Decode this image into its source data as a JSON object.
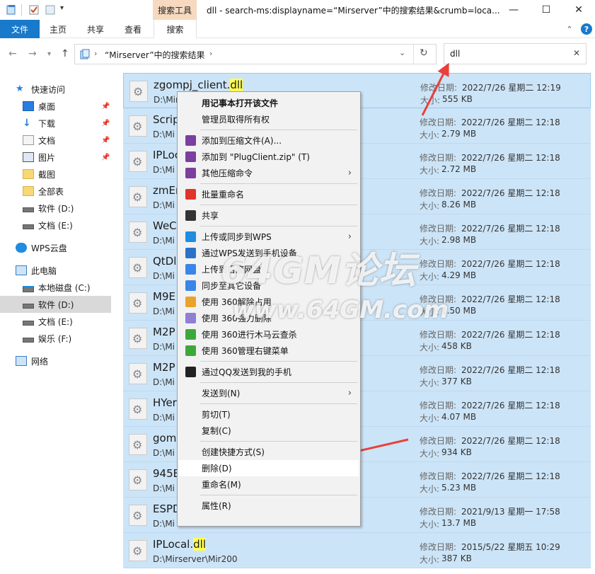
{
  "title_bar": {
    "context_tab": "搜索工具",
    "window_title": "dll - search-ms:displayname=“Mirserver”中的搜索结果&crumb=loca..."
  },
  "ribbon": {
    "tabs": [
      "文件",
      "主页",
      "共享",
      "查看",
      "搜索"
    ]
  },
  "address": {
    "path": "“Mirserver”中的搜索结果"
  },
  "search": {
    "value": "dll"
  },
  "sidebar": {
    "items": [
      {
        "label": "快速访问",
        "icon": "star-icon"
      },
      {
        "label": "桌面",
        "icon": "desktop-icon",
        "pinned": true
      },
      {
        "label": "下载",
        "icon": "download-icon",
        "pinned": true
      },
      {
        "label": "文档",
        "icon": "document-icon",
        "pinned": true
      },
      {
        "label": "图片",
        "icon": "picture-icon",
        "pinned": true
      },
      {
        "label": "截图",
        "icon": "folder-icon"
      },
      {
        "label": "全部表",
        "icon": "folder-icon"
      },
      {
        "label": "软件 (D:)",
        "icon": "drive-icon"
      },
      {
        "label": "文档 (E:)",
        "icon": "drive-icon"
      },
      {
        "label": "WPS云盘",
        "icon": "cloud-icon"
      },
      {
        "label": "此电脑",
        "icon": "computer-icon"
      },
      {
        "label": "本地磁盘 (C:)",
        "icon": "system-drive-icon"
      },
      {
        "label": "软件 (D:)",
        "icon": "drive-icon",
        "selected": true
      },
      {
        "label": "文档 (E:)",
        "icon": "drive-icon"
      },
      {
        "label": "娱乐 (F:)",
        "icon": "drive-icon"
      },
      {
        "label": "网络",
        "icon": "network-icon"
      }
    ]
  },
  "labels": {
    "modified": "修改日期:",
    "size": "大小:"
  },
  "files": [
    {
      "name_pre": "zgompj_client.",
      "name_hl": "dll",
      "path": "D:\\Mir",
      "modified": "2022/7/26 星期二 12:19",
      "size": "555 KB"
    },
    {
      "name_pre": "Scrip",
      "name_hl": "",
      "path": "D:\\Mi",
      "modified": "2022/7/26 星期二 12:18",
      "size": "2.79 MB"
    },
    {
      "name_pre": "IPLoc",
      "name_hl": "",
      "path": "D:\\Mi",
      "modified": "2022/7/26 星期二 12:18",
      "size": "2.72 MB"
    },
    {
      "name_pre": "zmEr",
      "name_hl": "",
      "path": "D:\\Mi",
      "modified": "2022/7/26 星期二 12:18",
      "size": "8.26 MB"
    },
    {
      "name_pre": "WeC",
      "name_hl": "",
      "path": "D:\\Mi",
      "modified": "2022/7/26 星期二 12:18",
      "size": "2.98 MB"
    },
    {
      "name_pre": "QtDl",
      "name_hl": "",
      "path": "D:\\Mi",
      "modified": "2022/7/26 星期二 12:18",
      "size": "4.29 MB"
    },
    {
      "name_pre": "M9E",
      "name_hl": "",
      "path": "D:\\Mi",
      "modified": "2022/7/26 星期二 12:18",
      "size": "1.50 MB"
    },
    {
      "name_pre": "M2P",
      "name_hl": "",
      "path": "D:\\Mi",
      "modified": "2022/7/26 星期二 12:18",
      "size": "458 KB"
    },
    {
      "name_pre": "M2P",
      "name_hl": "",
      "path": "D:\\Mi",
      "modified": "2022/7/26 星期二 12:18",
      "size": "377 KB"
    },
    {
      "name_pre": "HYer",
      "name_hl": "",
      "path": "D:\\Mi",
      "modified": "2022/7/26 星期二 12:18",
      "size": "4.07 MB"
    },
    {
      "name_pre": "gom",
      "name_hl": "",
      "path": "D:\\Mi",
      "modified": "2022/7/26 星期二 12:18",
      "size": "934 KB"
    },
    {
      "name_pre": "945E",
      "name_hl": "",
      "path": "D:\\Mi",
      "modified": "2022/7/26 星期二 12:18",
      "size": "5.23 MB"
    },
    {
      "name_pre": "ESPD",
      "name_hl": "",
      "path": "D:\\Mi",
      "modified": "2021/9/13 星期一 17:58",
      "size": "13.7 MB"
    },
    {
      "name_pre": "IPLocal.",
      "name_hl": "dll",
      "path": "D:\\Mirserver\\Mir200",
      "modified": "2015/5/22 星期五 10:29",
      "size": "387 KB"
    }
  ],
  "context_menu": [
    {
      "label": "用记事本打开该文件",
      "bold": true
    },
    {
      "label": "管理员取得所有权"
    },
    {
      "sep": true
    },
    {
      "label": "添加到压缩文件(A)...",
      "icon": "winrar-icon",
      "color": "#7a3fa0"
    },
    {
      "label": "添加到 \"PlugClient.zip\" (T)",
      "icon": "winrar-icon",
      "color": "#7a3fa0"
    },
    {
      "label": "其他压缩命令",
      "icon": "winrar-icon",
      "color": "#7a3fa0",
      "submenu": true
    },
    {
      "sep": true
    },
    {
      "label": "批量重命名",
      "icon": "wps-icon",
      "color": "#e0332a"
    },
    {
      "sep": true
    },
    {
      "label": "共享",
      "icon": "share-icon",
      "color": "#333333"
    },
    {
      "sep": true
    },
    {
      "label": "上传或同步到WPS",
      "icon": "wps-cloud-icon",
      "color": "#1f8de0",
      "submenu": true
    },
    {
      "label": "通过WPS发送到手机设备",
      "icon": "phone-icon",
      "color": "#2a72c6"
    },
    {
      "label": "上传到百度网盘",
      "icon": "baidu-icon",
      "color": "#3a86e8"
    },
    {
      "label": "同步至其它设备",
      "icon": "baidu-icon",
      "color": "#3a86e8"
    },
    {
      "label": "使用 360解除占用",
      "icon": "360-icon",
      "color": "#e8a32b"
    },
    {
      "label": "使用 360强力删除",
      "icon": "360-delete-icon",
      "color": "#8f7fd6"
    },
    {
      "label": "使用 360进行木马云查杀",
      "icon": "360-scan-icon",
      "color": "#3da83a"
    },
    {
      "label": "使用 360管理右键菜单",
      "icon": "360-scan-icon",
      "color": "#3da83a"
    },
    {
      "sep": true
    },
    {
      "label": "通过QQ发送到我的手机",
      "icon": "qq-icon",
      "color": "#222222"
    },
    {
      "sep": true
    },
    {
      "label": "发送到(N)",
      "submenu": true
    },
    {
      "sep": true
    },
    {
      "label": "剪切(T)"
    },
    {
      "label": "复制(C)"
    },
    {
      "sep": true
    },
    {
      "label": "创建快捷方式(S)"
    },
    {
      "label": "删除(D)",
      "hover": true
    },
    {
      "label": "重命名(M)"
    },
    {
      "sep": true
    },
    {
      "label": "属性(R)"
    }
  ],
  "watermark": {
    "main": "64GM论坛",
    "sub": "www.64GM.com"
  },
  "colors": {
    "accent": "#1979ca",
    "selection": "#cce4f7",
    "arrow": "#e8413a"
  }
}
